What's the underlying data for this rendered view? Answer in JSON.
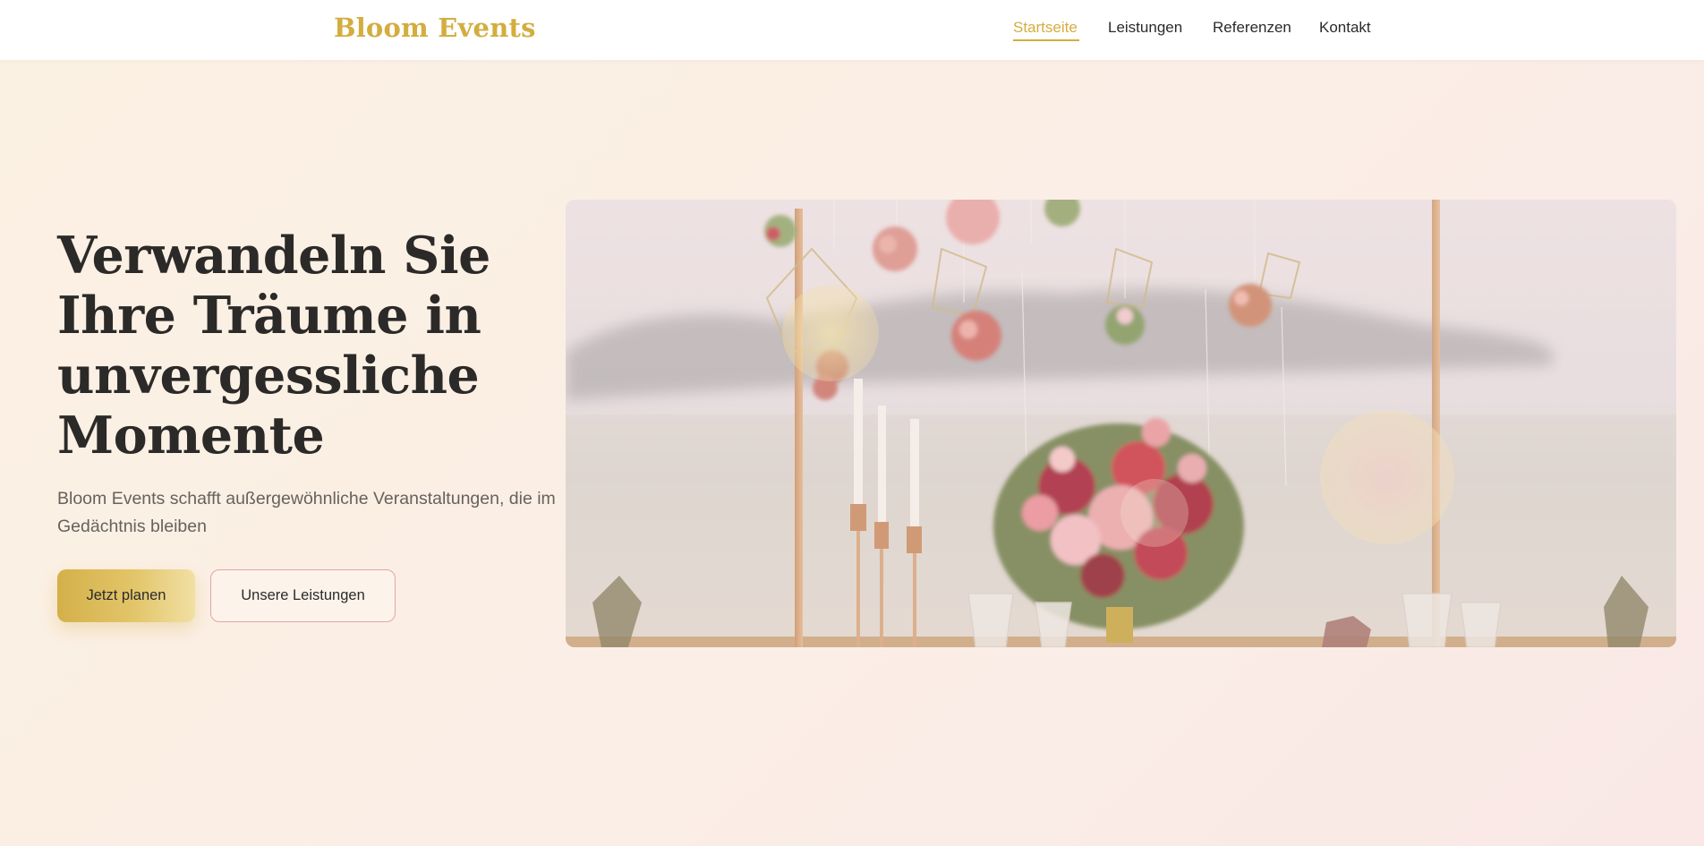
{
  "header": {
    "brand": "Bloom Events",
    "nav": [
      {
        "label": "Startseite",
        "active": true
      },
      {
        "label": "Leistungen",
        "active": false
      },
      {
        "label": "Referenzen",
        "active": false
      },
      {
        "label": "Kontakt",
        "active": false
      }
    ]
  },
  "hero": {
    "headline": "Verwandeln Sie Ihre Träume in unvergessliche Momente",
    "subtitle": "Bloom Events schafft außergewöhnliche Veranstaltungen, die im Gedächtnis bleiben",
    "primary_cta": "Jetzt planen",
    "secondary_cta": "Unsere Leistungen",
    "image_description": "wedding-table-flowers-photo"
  },
  "colors": {
    "accent_gold": "#d3ad3f",
    "rose_border": "#e2a5a7",
    "heading": "#2b2a28",
    "body_text": "#66625d"
  }
}
